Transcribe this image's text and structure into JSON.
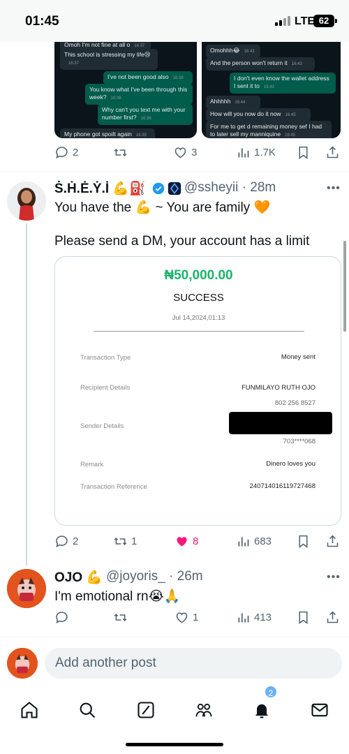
{
  "status_bar": {
    "time": "01:45",
    "network": "LTE",
    "battery": "62"
  },
  "chat_left": {
    "messages": [
      {
        "text": "Omoh I'm not fine at all o",
        "time": "16:37",
        "dir": "in"
      },
      {
        "text": "This school is stressing my life😢",
        "time": "16:37",
        "dir": "in"
      },
      {
        "text": "I've not been good also",
        "time": "16:38",
        "dir": "out"
      },
      {
        "text": "You know what I've been through this week?",
        "time": "16:38",
        "dir": "out"
      },
      {
        "text": "Why can't you text me with your number first?",
        "time": "16:38",
        "dir": "out"
      },
      {
        "text": "My phone got spoilt again",
        "time": "16:39",
        "dir": "in"
      }
    ]
  },
  "chat_right": {
    "messages": [
      {
        "text": "Omohhh😂",
        "time": "16:43",
        "dir": "in"
      },
      {
        "text": "And the person won't return it",
        "time": "16:43",
        "dir": "in"
      },
      {
        "text": "I don't even know the wallet address I sent it to",
        "time": "16:43",
        "dir": "out"
      },
      {
        "text": "Ahhhhh",
        "time": "16:44",
        "dir": "in"
      },
      {
        "text": "How will you now do it now",
        "time": "16:45",
        "dir": "in"
      },
      {
        "text": "For me to get d remaining money sef I had to later sell my manniquine",
        "time": "16:45",
        "dir": "in"
      }
    ]
  },
  "prev_tweet_actions": {
    "replies": "2",
    "reposts": "",
    "likes": "3",
    "views": "1.7K"
  },
  "tweet1": {
    "name": "Ṡ.Ḣ.Ė.Ẏ.İ 💪⛽",
    "handle": "@ssheyii",
    "time": "28m",
    "line1": "You have the 💪 ~ You are family 🧡",
    "line2": "Please send a DM, your account has a limit",
    "actions": {
      "replies": "2",
      "reposts": "1",
      "likes": "8",
      "views": "683"
    }
  },
  "receipt": {
    "amount": "₦50,000.00",
    "status": "SUCCESS",
    "date": "Jul 14,2024,01:13",
    "rows": [
      {
        "label": "Transaction Type",
        "value": "Money sent",
        "sub": ""
      },
      {
        "label": "Recipient Details",
        "value": "FUNMILAYO RUTH OJO",
        "sub": "802 256 8527"
      },
      {
        "label": "Sender Details",
        "value": "",
        "sub": "703****068"
      },
      {
        "label": "Remark",
        "value": "Dinero loves you",
        "sub": ""
      },
      {
        "label": "Transaction Reference",
        "value": "240714016119727468",
        "sub": ""
      }
    ]
  },
  "tweet2": {
    "name": "OJO 💪",
    "handle": "@joyoris_",
    "time": "26m",
    "text": "I'm emotional rn😭🙏",
    "actions": {
      "replies": "",
      "reposts": "",
      "likes": "1",
      "views": "413"
    }
  },
  "compose": {
    "placeholder": "Add another post"
  },
  "nav": {
    "items": [
      "home-icon",
      "search-icon",
      "grok-icon",
      "communities-icon",
      "notifications-icon",
      "messages-icon"
    ],
    "notification_badge": "2"
  },
  "colors": {
    "like": "#f91880",
    "accent": "#1d9bf0",
    "amount": "#1bb36b"
  }
}
